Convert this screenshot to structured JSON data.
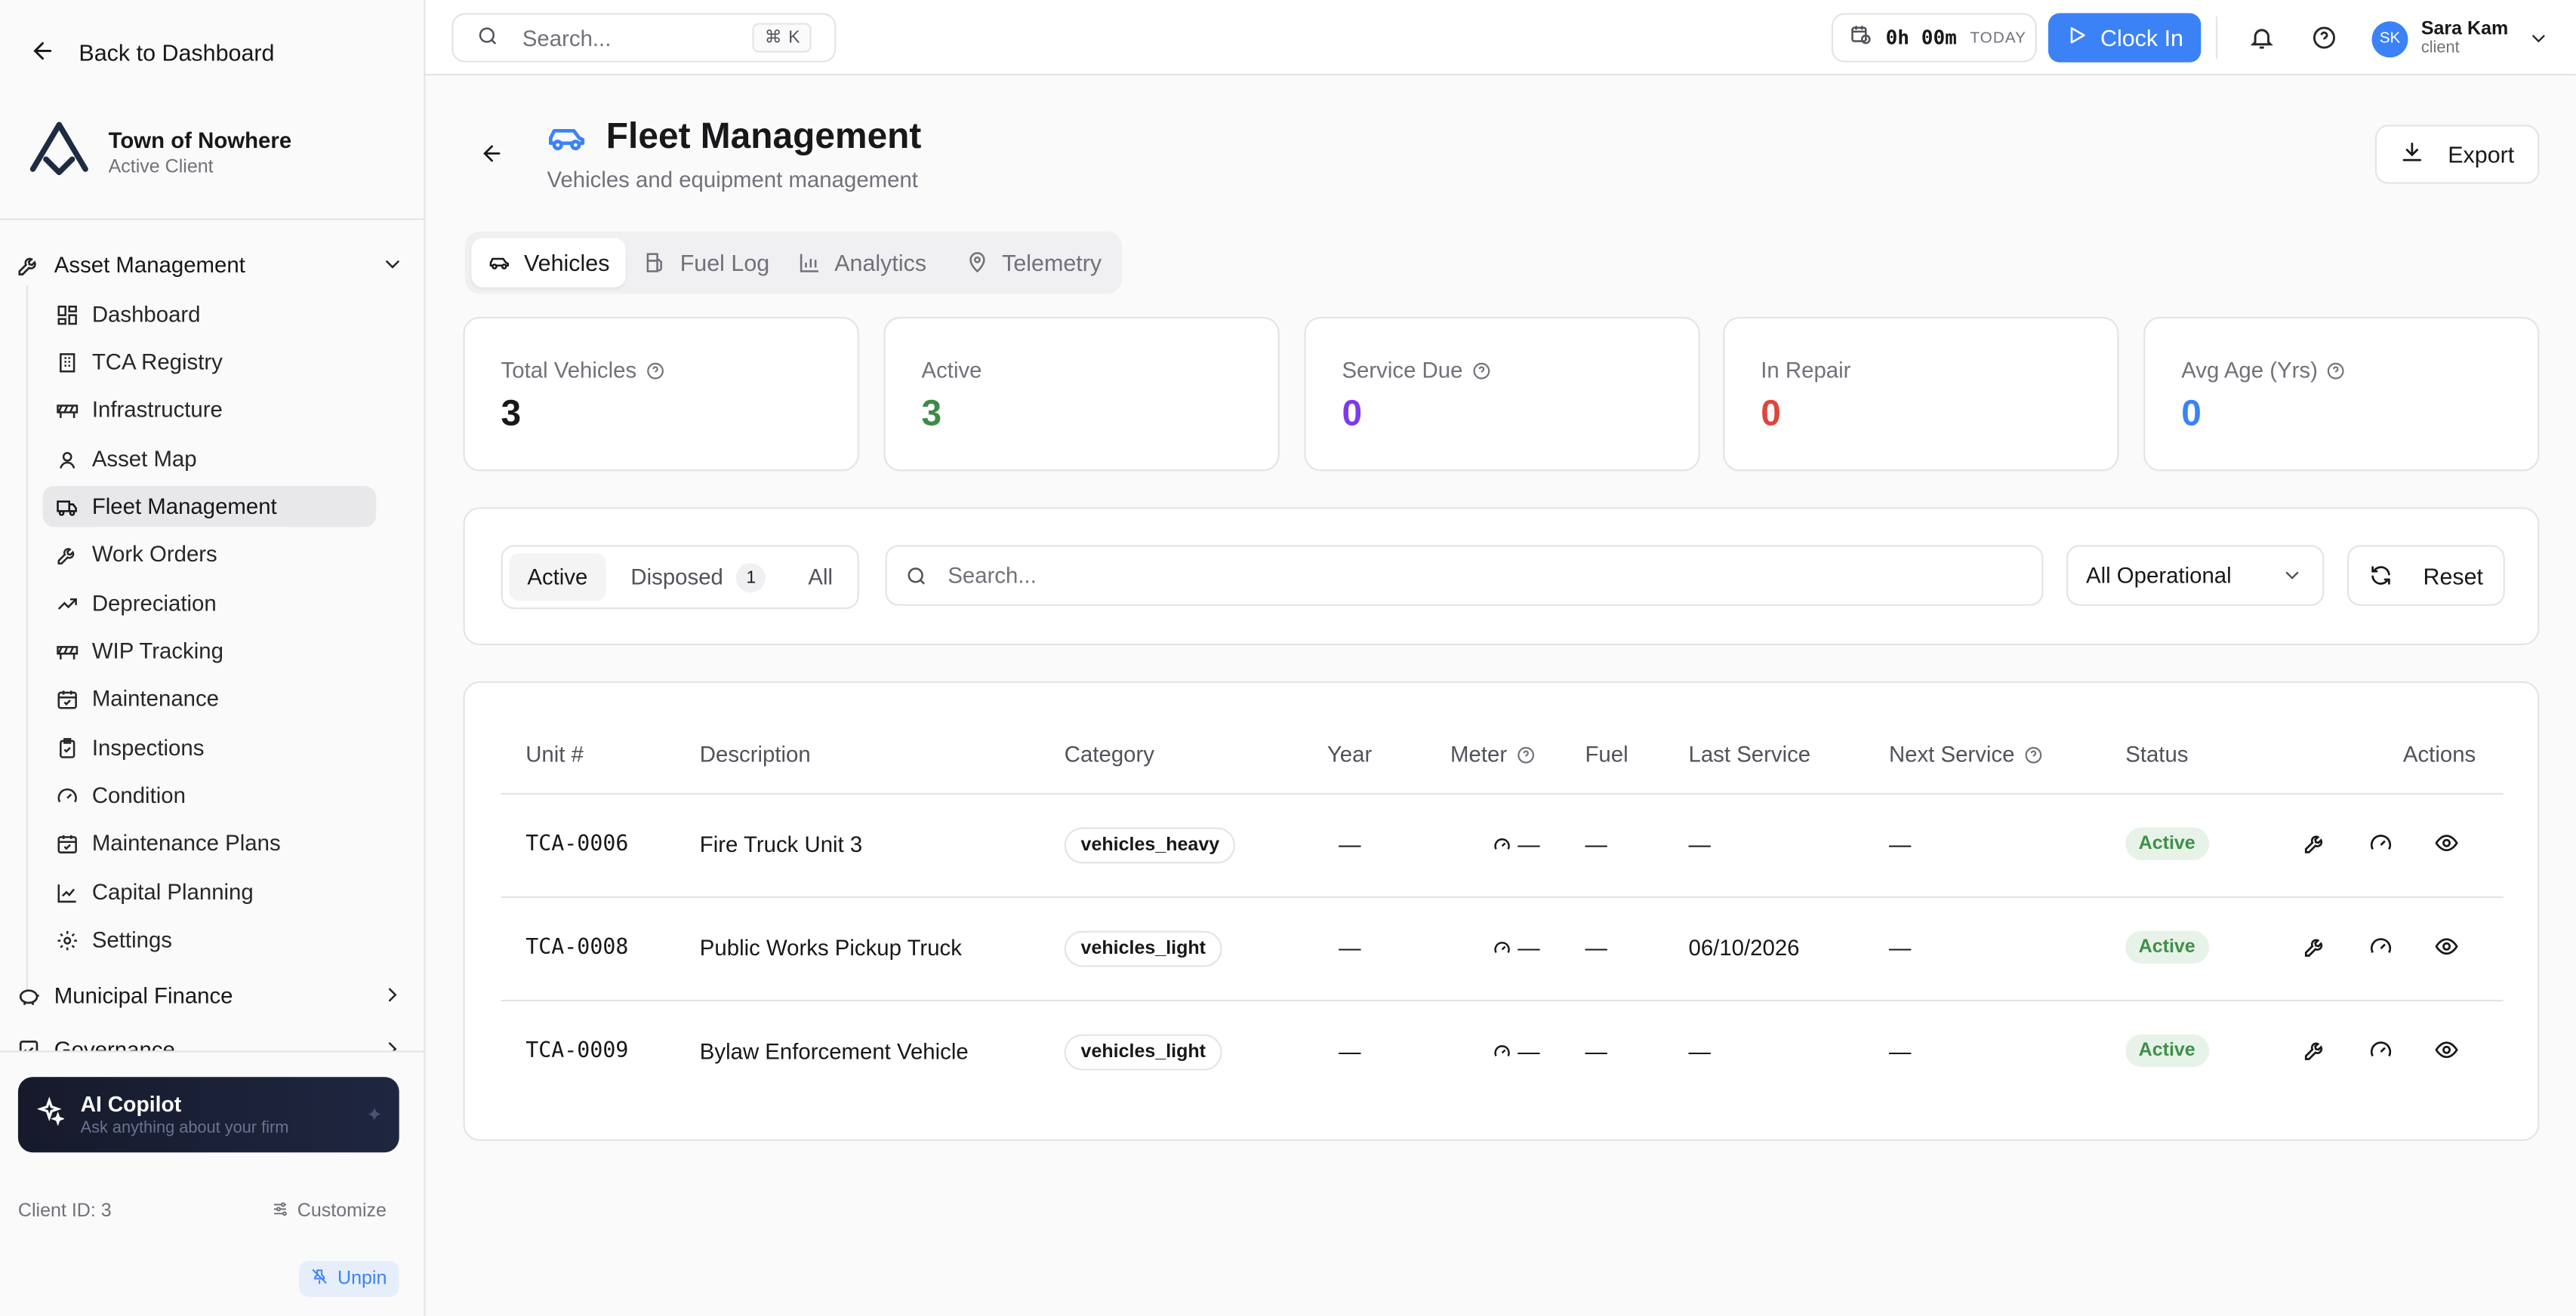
{
  "sidebar": {
    "back_label": "Back to Dashboard",
    "client_name": "Town of Nowhere",
    "client_status": "Active Client",
    "group_asset": "Asset Management",
    "items": [
      {
        "label": "Dashboard",
        "icon": "grid-icon"
      },
      {
        "label": "TCA Registry",
        "icon": "building-icon"
      },
      {
        "label": "Infrastructure",
        "icon": "barrier-icon"
      },
      {
        "label": "Asset Map",
        "icon": "map-pin-icon"
      },
      {
        "label": "Fleet Management",
        "icon": "truck-icon"
      },
      {
        "label": "Work Orders",
        "icon": "wrench-icon"
      },
      {
        "label": "Depreciation",
        "icon": "trending-icon"
      },
      {
        "label": "WIP Tracking",
        "icon": "barrier-icon"
      },
      {
        "label": "Maintenance",
        "icon": "calendar-icon"
      },
      {
        "label": "Inspections",
        "icon": "clipboard-icon"
      },
      {
        "label": "Condition",
        "icon": "gauge-icon"
      },
      {
        "label": "Maintenance Plans",
        "icon": "calendar-icon"
      },
      {
        "label": "Capital Planning",
        "icon": "chart-icon"
      },
      {
        "label": "Settings",
        "icon": "gear-icon"
      }
    ],
    "group_finance": "Municipal Finance",
    "group_governance": "Governance",
    "copilot_title": "AI Copilot",
    "copilot_sub": "Ask anything about your firm",
    "client_id": "Client ID: 3",
    "customize": "Customize",
    "unpin": "Unpin"
  },
  "topbar": {
    "search_placeholder": "Search...",
    "shortcut_key": "K",
    "timer": "0h 00m",
    "timer_label": "TODAY",
    "clock_in": "Clock In",
    "user_initials": "SK",
    "user_name": "Sara Kam",
    "user_role": "client"
  },
  "page": {
    "title": "Fleet Management",
    "subtitle": "Vehicles and equipment management",
    "export": "Export",
    "tabs": [
      "Vehicles",
      "Fuel Log",
      "Analytics",
      "Telemetry"
    ]
  },
  "stats": [
    {
      "label": "Total Vehicles",
      "value": "3",
      "color": "#18181b"
    },
    {
      "label": "Active",
      "value": "3",
      "color": "#3d8b48"
    },
    {
      "label": "Service Due",
      "value": "0",
      "color": "#7c3aed"
    },
    {
      "label": "In Repair",
      "value": "0",
      "color": "#e0453b"
    },
    {
      "label": "Avg Age (Yrs)",
      "value": "0",
      "color": "#3b82f6"
    }
  ],
  "filters": {
    "seg_active": "Active",
    "seg_disposed": "Disposed",
    "disposed_count": "1",
    "seg_all": "All",
    "search_placeholder": "Search...",
    "select_value": "All Operational",
    "reset": "Reset"
  },
  "table": {
    "headers": [
      "Unit #",
      "Description",
      "Category",
      "Year",
      "Meter",
      "Fuel",
      "Last Service",
      "Next Service",
      "Status",
      "Actions"
    ],
    "rows": [
      {
        "unit": "TCA-0006",
        "description": "Fire Truck Unit 3",
        "category": "vehicles_heavy",
        "year": "—",
        "meter": "—",
        "fuel": "—",
        "last_service": "—",
        "next_service": "—",
        "status": "Active"
      },
      {
        "unit": "TCA-0008",
        "description": "Public Works Pickup Truck",
        "category": "vehicles_light",
        "year": "—",
        "meter": "—",
        "fuel": "—",
        "last_service": "06/10/2026",
        "next_service": "—",
        "status": "Active"
      },
      {
        "unit": "TCA-0009",
        "description": "Bylaw Enforcement Vehicle",
        "category": "vehicles_light",
        "year": "—",
        "meter": "—",
        "fuel": "—",
        "last_service": "—",
        "next_service": "—",
        "status": "Active"
      }
    ]
  }
}
